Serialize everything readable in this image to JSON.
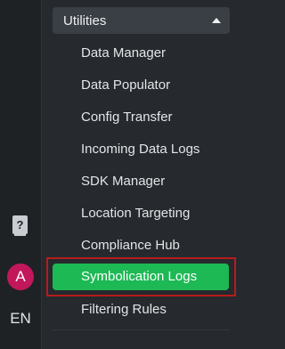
{
  "rail": {
    "help_icon": "help-question-icon",
    "avatar_initial": "A",
    "avatar_color": "#c2185b",
    "language": "EN"
  },
  "section": {
    "title": "Utilities",
    "expanded": true,
    "items": [
      {
        "label": "Data Manager",
        "active": false
      },
      {
        "label": "Data Populator",
        "active": false
      },
      {
        "label": "Config Transfer",
        "active": false
      },
      {
        "label": "Incoming Data Logs",
        "active": false
      },
      {
        "label": "SDK Manager",
        "active": false
      },
      {
        "label": "Location Targeting",
        "active": false
      },
      {
        "label": "Compliance Hub",
        "active": false
      },
      {
        "label": "Symbolication Logs",
        "active": true
      },
      {
        "label": "Filtering Rules",
        "active": false
      }
    ]
  },
  "colors": {
    "active_item": "#1db954",
    "selection_outline": "#b71c1c",
    "background": "#26292d"
  }
}
